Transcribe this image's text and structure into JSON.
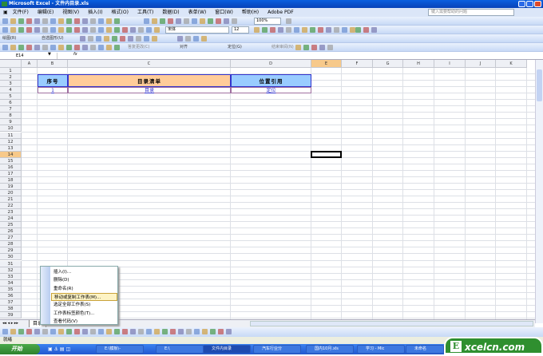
{
  "window": {
    "title": "Microsoft Excel - 文件内目录.xls"
  },
  "menu": [
    "文件(F)",
    "编辑(E)",
    "视图(V)",
    "插入(I)",
    "格式(O)",
    "工具(T)",
    "数据(D)",
    "表单(W)",
    "窗口(W)",
    "帮助(H)",
    "Adobe PDF"
  ],
  "help_placeholder": "键入需要帮助的问题",
  "toolbar": {
    "zoom": "100%",
    "font": "宋体",
    "size": "12",
    "draw_label": "绘图(R)",
    "autoshape_label": "自选图形(U)",
    "align_label": "对齐",
    "locate_label": "定位(G)",
    "reply_label": "答复更改(C)",
    "end_review_label": "结束审阅(N)"
  },
  "formula_bar": {
    "name_box": "E14",
    "fx": "fx"
  },
  "columns": [
    "A",
    "B",
    "C",
    "D",
    "E",
    "F",
    "G",
    "H",
    "I",
    "J",
    "K"
  ],
  "selected_cell": "E14",
  "cells": {
    "B2": "序号",
    "C2": "目录清单",
    "D2": "位置引用",
    "B4": "1",
    "C4": "目录",
    "D4": "定位"
  },
  "context_menu": {
    "items": [
      "插入(I)...",
      "删除(D)",
      "重命名(R)",
      "移动或复制工作表(M)...",
      "选定全部工作表(S)",
      "工作表标签颜色(T)...",
      "查看代码(V)"
    ],
    "highlighted": 3
  },
  "sheet_tabs": [
    "目录"
  ],
  "status": "就绪",
  "taskbar": {
    "start": "开始",
    "items": [
      "E:\\模板\\-",
      "E:\\",
      "文件内目录",
      "汽车行业分",
      "国内10月.xls",
      "学习 - Mic",
      "未命名"
    ],
    "active": 2
  },
  "watermark": "Excelcn.com",
  "colors": {
    "header_blue": "#99ccff",
    "header_orange": "#ffcc99",
    "border": "#3333cc",
    "link": "#3333cc"
  }
}
